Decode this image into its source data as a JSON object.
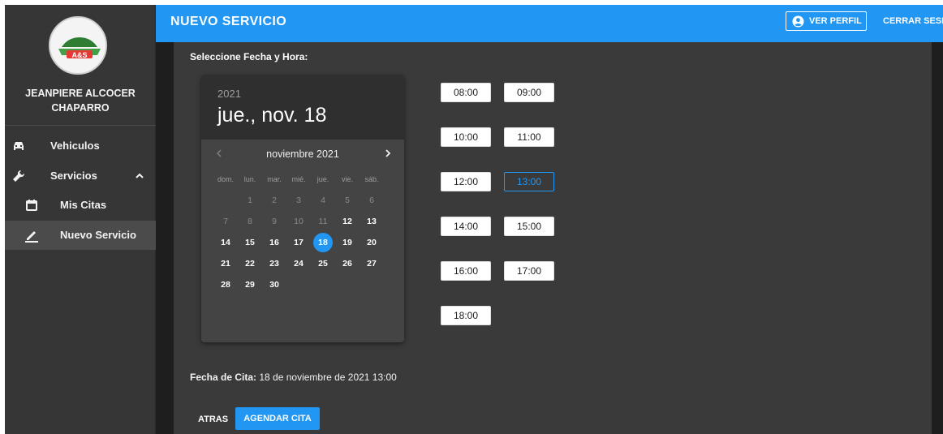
{
  "sidebar": {
    "user_name": "JEANPIERE ALCOCER CHAPARRO",
    "logo_text": "A&S",
    "items": [
      {
        "label": "Vehiculos",
        "icon": "car-icon"
      },
      {
        "label": "Servicios",
        "icon": "wrench-icon",
        "expanded": true
      },
      {
        "label": "Mis Citas",
        "icon": "calendar-icon"
      },
      {
        "label": "Nuevo Servicio",
        "icon": "pencil-icon",
        "active": true
      }
    ]
  },
  "topbar": {
    "title": "NUEVO SERVICIO",
    "profile_label": "VER PERFIL",
    "logout_label": "CERRAR SESIÓN"
  },
  "form": {
    "select_label": "Seleccione Fecha y Hora:",
    "date_label": "Fecha de Cita:",
    "date_value": "18 de noviembre de 2021 13:00",
    "back_label": "ATRAS",
    "submit_label": "AGENDAR CITA"
  },
  "calendar": {
    "year": "2021",
    "selected_display": "jue., nov. 18",
    "month_label": "noviembre 2021",
    "weekdays": [
      "dom.",
      "lun.",
      "mar.",
      "mié.",
      "jue.",
      "vie.",
      "sáb."
    ],
    "first_weekday_index": 1,
    "days_in_month": 30,
    "min_enabled_day": 12,
    "selected_day": 18
  },
  "time_slots": [
    "08:00",
    "09:00",
    "10:00",
    "11:00",
    "12:00",
    "13:00",
    "14:00",
    "15:00",
    "16:00",
    "17:00",
    "18:00"
  ],
  "selected_slot": "13:00",
  "colors": {
    "accent": "#2196f3",
    "sidebar_bg": "#363636",
    "content_bg": "#3a3a3a"
  }
}
